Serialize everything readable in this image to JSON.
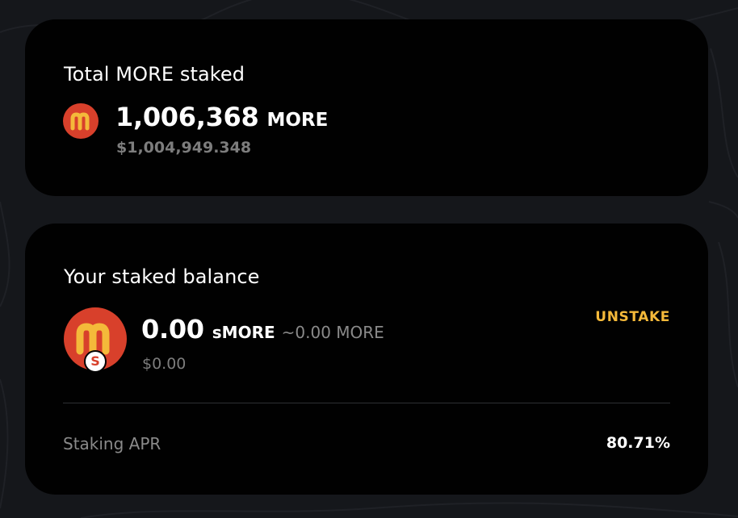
{
  "colors": {
    "background": "#15171b",
    "card": "#010101",
    "logo": "#d8402b",
    "logo_glyph": "#f4b93a",
    "accent": "#f4b93a",
    "muted": "#8a8a8a"
  },
  "total_staked": {
    "title": "Total MORE staked",
    "token_icon": "more-token-icon",
    "amount": "1,006,368",
    "unit": "MORE",
    "usd_value": "$1,004,949.348"
  },
  "your_balance": {
    "title": "Your staked balance",
    "token_icon": "smore-token-icon",
    "badge": "S",
    "amount": "0.00",
    "unit": "sMORE",
    "equivalent": "~0.00 MORE",
    "usd_value": "$0.00",
    "action_label": "UNSTAKE"
  },
  "apr": {
    "label": "Staking APR",
    "value": "80.71%"
  }
}
